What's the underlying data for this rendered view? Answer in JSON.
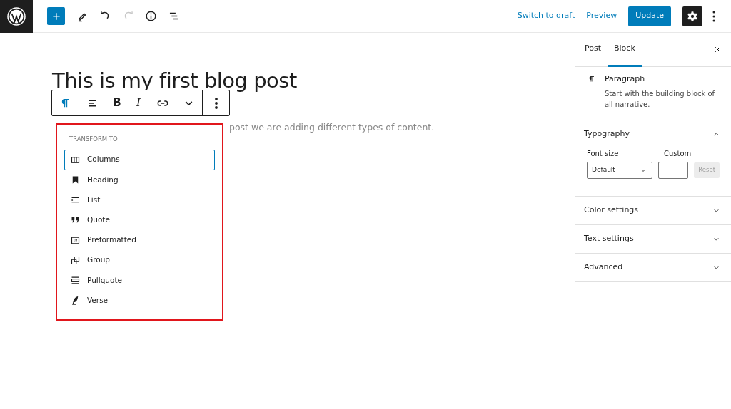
{
  "topbar": {
    "tools": [
      {
        "kind": "add",
        "disabled": false
      },
      {
        "kind": "edit",
        "disabled": false
      },
      {
        "kind": "undo",
        "disabled": false
      },
      {
        "kind": "redo",
        "disabled": true
      },
      {
        "kind": "info",
        "disabled": false
      },
      {
        "kind": "outline",
        "disabled": false
      }
    ],
    "links": [
      "Switch to draft",
      "Preview"
    ],
    "update": "Update",
    "settings_selected": true
  },
  "editor": {
    "title": "This is my first blog post",
    "paragraph_after": "post we are adding different types of content."
  },
  "block_toolbar": [
    {
      "kind": "paragraph",
      "selected": true
    },
    {
      "kind": "align",
      "selected": false
    },
    {
      "kind": "bold",
      "text": "B",
      "selected": false
    },
    {
      "kind": "italic",
      "text": "I",
      "selected": false
    },
    {
      "kind": "link",
      "selected": false
    },
    {
      "kind": "more",
      "selected": false
    },
    {
      "kind": "options",
      "selected": false
    }
  ],
  "transform_menu": {
    "heading": "TRANSFORM TO",
    "items": [
      {
        "label": "Columns",
        "kind": "columns",
        "selected": true
      },
      {
        "label": "Heading",
        "kind": "heading",
        "selected": false
      },
      {
        "label": "List",
        "kind": "list",
        "selected": false
      },
      {
        "label": "Quote",
        "kind": "quote",
        "selected": false
      },
      {
        "label": "Preformatted",
        "kind": "preformatted",
        "selected": false
      },
      {
        "label": "Group",
        "kind": "group",
        "selected": false
      },
      {
        "label": "Pullquote",
        "kind": "pullquote",
        "selected": false
      },
      {
        "label": "Verse",
        "kind": "verse",
        "selected": false
      }
    ]
  },
  "sidebar": {
    "tabs": [
      {
        "label": "Post",
        "selected": false
      },
      {
        "label": "Block",
        "selected": true
      }
    ],
    "block": {
      "title": "Paragraph",
      "description": "Start with the building block of all narrative."
    },
    "panels": [
      {
        "title": "Typography",
        "expanded": true
      },
      {
        "title": "Color settings",
        "expanded": false
      },
      {
        "title": "Text settings",
        "expanded": false
      },
      {
        "title": "Advanced",
        "expanded": false
      }
    ],
    "typography": {
      "font_size_label": "Font size",
      "custom_label": "Custom",
      "font_size_value": "Default",
      "reset": "Reset"
    }
  }
}
